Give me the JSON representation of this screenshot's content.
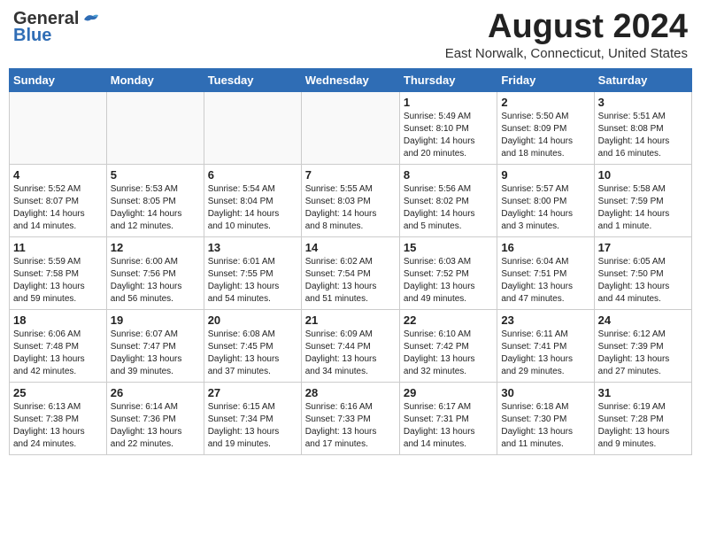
{
  "logo": {
    "line1a": "General",
    "line1b": "Blue",
    "line2": "Blue"
  },
  "header": {
    "month": "August 2024",
    "location": "East Norwalk, Connecticut, United States"
  },
  "weekdays": [
    "Sunday",
    "Monday",
    "Tuesday",
    "Wednesday",
    "Thursday",
    "Friday",
    "Saturday"
  ],
  "weeks": [
    [
      {
        "day": "",
        "info": ""
      },
      {
        "day": "",
        "info": ""
      },
      {
        "day": "",
        "info": ""
      },
      {
        "day": "",
        "info": ""
      },
      {
        "day": "1",
        "info": "Sunrise: 5:49 AM\nSunset: 8:10 PM\nDaylight: 14 hours\nand 20 minutes."
      },
      {
        "day": "2",
        "info": "Sunrise: 5:50 AM\nSunset: 8:09 PM\nDaylight: 14 hours\nand 18 minutes."
      },
      {
        "day": "3",
        "info": "Sunrise: 5:51 AM\nSunset: 8:08 PM\nDaylight: 14 hours\nand 16 minutes."
      }
    ],
    [
      {
        "day": "4",
        "info": "Sunrise: 5:52 AM\nSunset: 8:07 PM\nDaylight: 14 hours\nand 14 minutes."
      },
      {
        "day": "5",
        "info": "Sunrise: 5:53 AM\nSunset: 8:05 PM\nDaylight: 14 hours\nand 12 minutes."
      },
      {
        "day": "6",
        "info": "Sunrise: 5:54 AM\nSunset: 8:04 PM\nDaylight: 14 hours\nand 10 minutes."
      },
      {
        "day": "7",
        "info": "Sunrise: 5:55 AM\nSunset: 8:03 PM\nDaylight: 14 hours\nand 8 minutes."
      },
      {
        "day": "8",
        "info": "Sunrise: 5:56 AM\nSunset: 8:02 PM\nDaylight: 14 hours\nand 5 minutes."
      },
      {
        "day": "9",
        "info": "Sunrise: 5:57 AM\nSunset: 8:00 PM\nDaylight: 14 hours\nand 3 minutes."
      },
      {
        "day": "10",
        "info": "Sunrise: 5:58 AM\nSunset: 7:59 PM\nDaylight: 14 hours\nand 1 minute."
      }
    ],
    [
      {
        "day": "11",
        "info": "Sunrise: 5:59 AM\nSunset: 7:58 PM\nDaylight: 13 hours\nand 59 minutes."
      },
      {
        "day": "12",
        "info": "Sunrise: 6:00 AM\nSunset: 7:56 PM\nDaylight: 13 hours\nand 56 minutes."
      },
      {
        "day": "13",
        "info": "Sunrise: 6:01 AM\nSunset: 7:55 PM\nDaylight: 13 hours\nand 54 minutes."
      },
      {
        "day": "14",
        "info": "Sunrise: 6:02 AM\nSunset: 7:54 PM\nDaylight: 13 hours\nand 51 minutes."
      },
      {
        "day": "15",
        "info": "Sunrise: 6:03 AM\nSunset: 7:52 PM\nDaylight: 13 hours\nand 49 minutes."
      },
      {
        "day": "16",
        "info": "Sunrise: 6:04 AM\nSunset: 7:51 PM\nDaylight: 13 hours\nand 47 minutes."
      },
      {
        "day": "17",
        "info": "Sunrise: 6:05 AM\nSunset: 7:50 PM\nDaylight: 13 hours\nand 44 minutes."
      }
    ],
    [
      {
        "day": "18",
        "info": "Sunrise: 6:06 AM\nSunset: 7:48 PM\nDaylight: 13 hours\nand 42 minutes."
      },
      {
        "day": "19",
        "info": "Sunrise: 6:07 AM\nSunset: 7:47 PM\nDaylight: 13 hours\nand 39 minutes."
      },
      {
        "day": "20",
        "info": "Sunrise: 6:08 AM\nSunset: 7:45 PM\nDaylight: 13 hours\nand 37 minutes."
      },
      {
        "day": "21",
        "info": "Sunrise: 6:09 AM\nSunset: 7:44 PM\nDaylight: 13 hours\nand 34 minutes."
      },
      {
        "day": "22",
        "info": "Sunrise: 6:10 AM\nSunset: 7:42 PM\nDaylight: 13 hours\nand 32 minutes."
      },
      {
        "day": "23",
        "info": "Sunrise: 6:11 AM\nSunset: 7:41 PM\nDaylight: 13 hours\nand 29 minutes."
      },
      {
        "day": "24",
        "info": "Sunrise: 6:12 AM\nSunset: 7:39 PM\nDaylight: 13 hours\nand 27 minutes."
      }
    ],
    [
      {
        "day": "25",
        "info": "Sunrise: 6:13 AM\nSunset: 7:38 PM\nDaylight: 13 hours\nand 24 minutes."
      },
      {
        "day": "26",
        "info": "Sunrise: 6:14 AM\nSunset: 7:36 PM\nDaylight: 13 hours\nand 22 minutes."
      },
      {
        "day": "27",
        "info": "Sunrise: 6:15 AM\nSunset: 7:34 PM\nDaylight: 13 hours\nand 19 minutes."
      },
      {
        "day": "28",
        "info": "Sunrise: 6:16 AM\nSunset: 7:33 PM\nDaylight: 13 hours\nand 17 minutes."
      },
      {
        "day": "29",
        "info": "Sunrise: 6:17 AM\nSunset: 7:31 PM\nDaylight: 13 hours\nand 14 minutes."
      },
      {
        "day": "30",
        "info": "Sunrise: 6:18 AM\nSunset: 7:30 PM\nDaylight: 13 hours\nand 11 minutes."
      },
      {
        "day": "31",
        "info": "Sunrise: 6:19 AM\nSunset: 7:28 PM\nDaylight: 13 hours\nand 9 minutes."
      }
    ]
  ]
}
